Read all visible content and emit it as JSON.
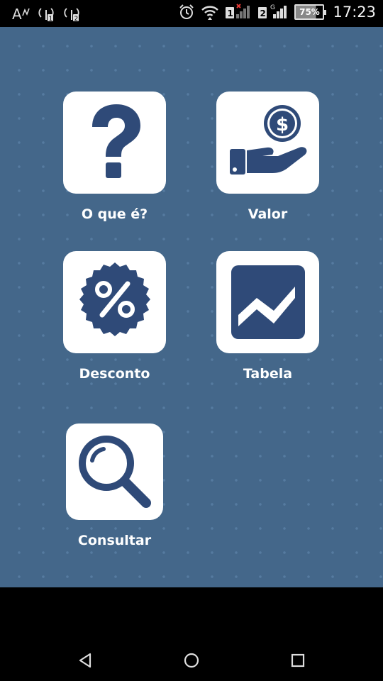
{
  "status_bar": {
    "time": "17:23",
    "battery_percent": "75%",
    "sim1_label": "1",
    "sim2_label": "2",
    "network_type": "G",
    "icons": [
      "font-icon",
      "signal-sim1-icon",
      "signal-sim2-icon",
      "alarm-icon",
      "wifi-icon",
      "sim1-signal-icon",
      "sim2-signal-icon",
      "battery-icon"
    ]
  },
  "menu": {
    "items": [
      {
        "label": "O que é?",
        "icon": "question-icon"
      },
      {
        "label": "Valor",
        "icon": "money-hand-icon"
      },
      {
        "label": "Desconto",
        "icon": "percent-badge-icon"
      },
      {
        "label": "Tabela",
        "icon": "chart-icon"
      },
      {
        "label": "Consultar",
        "icon": "search-icon"
      }
    ]
  },
  "colors": {
    "background": "#44678a",
    "icon": "#2f4a78",
    "tile": "#ffffff",
    "label": "#ffffff"
  },
  "nav": {
    "buttons": [
      "back-icon",
      "home-icon",
      "recents-icon"
    ]
  }
}
